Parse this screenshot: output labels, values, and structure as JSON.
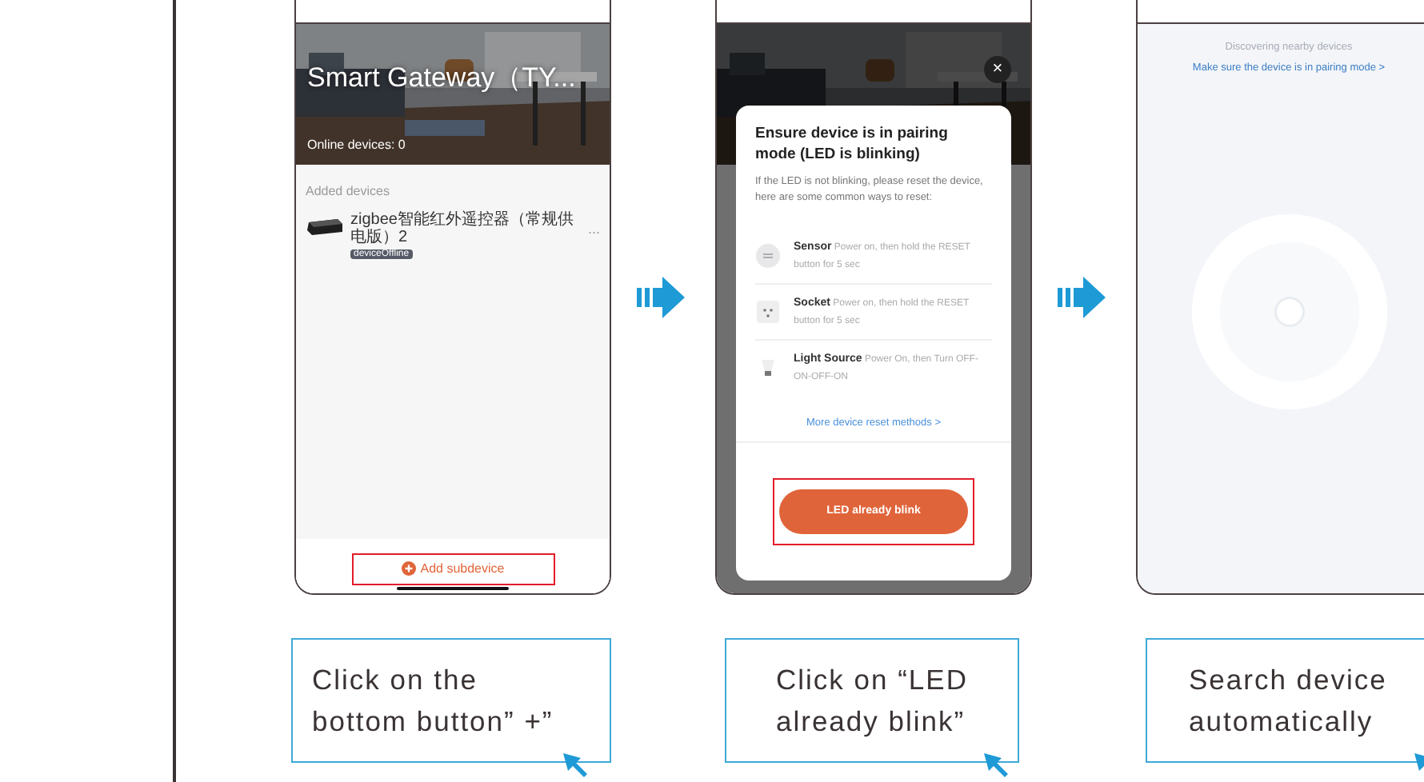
{
  "steps": [
    {
      "kind": "gateway",
      "title": "Smart Gateway（TY...",
      "online": "Online devices: 0",
      "section": "Added devices",
      "device": {
        "name": "zigbee智能红外遥控器（常规供电版）2",
        "status": "deviceOffline",
        "more": "..."
      },
      "action": "Add subdevice",
      "highlighted": true,
      "caption": "Click on the\nbottom button” +”"
    },
    {
      "kind": "pairing",
      "close": "×",
      "title": "Ensure device is in pairing mode (LED is blinking)",
      "text": "If the LED is not blinking, please reset the device, here are some common ways to reset:",
      "methods": [
        {
          "kind": "sensor",
          "text": "**Sensor** Power on, then hold the RESET button for 5 sec"
        },
        {
          "kind": "socket",
          "text": "**Socket** Power on, then hold the RESET button for 5 sec"
        },
        {
          "kind": "bulb",
          "text": "**Light Source** Power On, then Turn OFF-ON-OFF-ON"
        }
      ],
      "link": "More device reset methods >",
      "action": "LED already blink",
      "highlighted": true,
      "caption": "Click on “LED\nalready blink”"
    },
    {
      "kind": "search",
      "status": "Discovering nearby devices",
      "link": "Make sure the device is in pairing mode >",
      "caption": "Search device\nautomatically"
    }
  ]
}
